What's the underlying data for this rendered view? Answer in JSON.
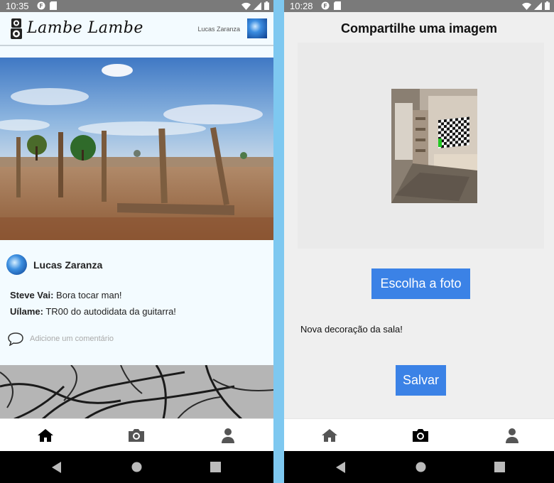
{
  "left": {
    "status": {
      "time": "10:35"
    },
    "header": {
      "app_name": "Lambe Lambe",
      "user_name": "Lucas Zaranza"
    },
    "post": {
      "author": "Lucas Zaranza",
      "comments": [
        {
          "user": "Steve Vai:",
          "text": " Bora tocar man!"
        },
        {
          "user": "Uílame:",
          "text": " TR00 do autodidata da guitarra!"
        }
      ],
      "add_comment_placeholder": "Adicione um comentário"
    }
  },
  "right": {
    "status": {
      "time": "10:28"
    },
    "title": "Compartilhe uma imagem",
    "choose_photo_label": "Escolha a foto",
    "caption_value": "Nova decoração da sala!",
    "save_label": "Salvar"
  },
  "tabs": [
    "home-icon",
    "camera-icon",
    "user-icon"
  ],
  "colors": {
    "accent": "#3b82e6",
    "tab_active": "#000000",
    "tab_inactive": "#555555"
  }
}
